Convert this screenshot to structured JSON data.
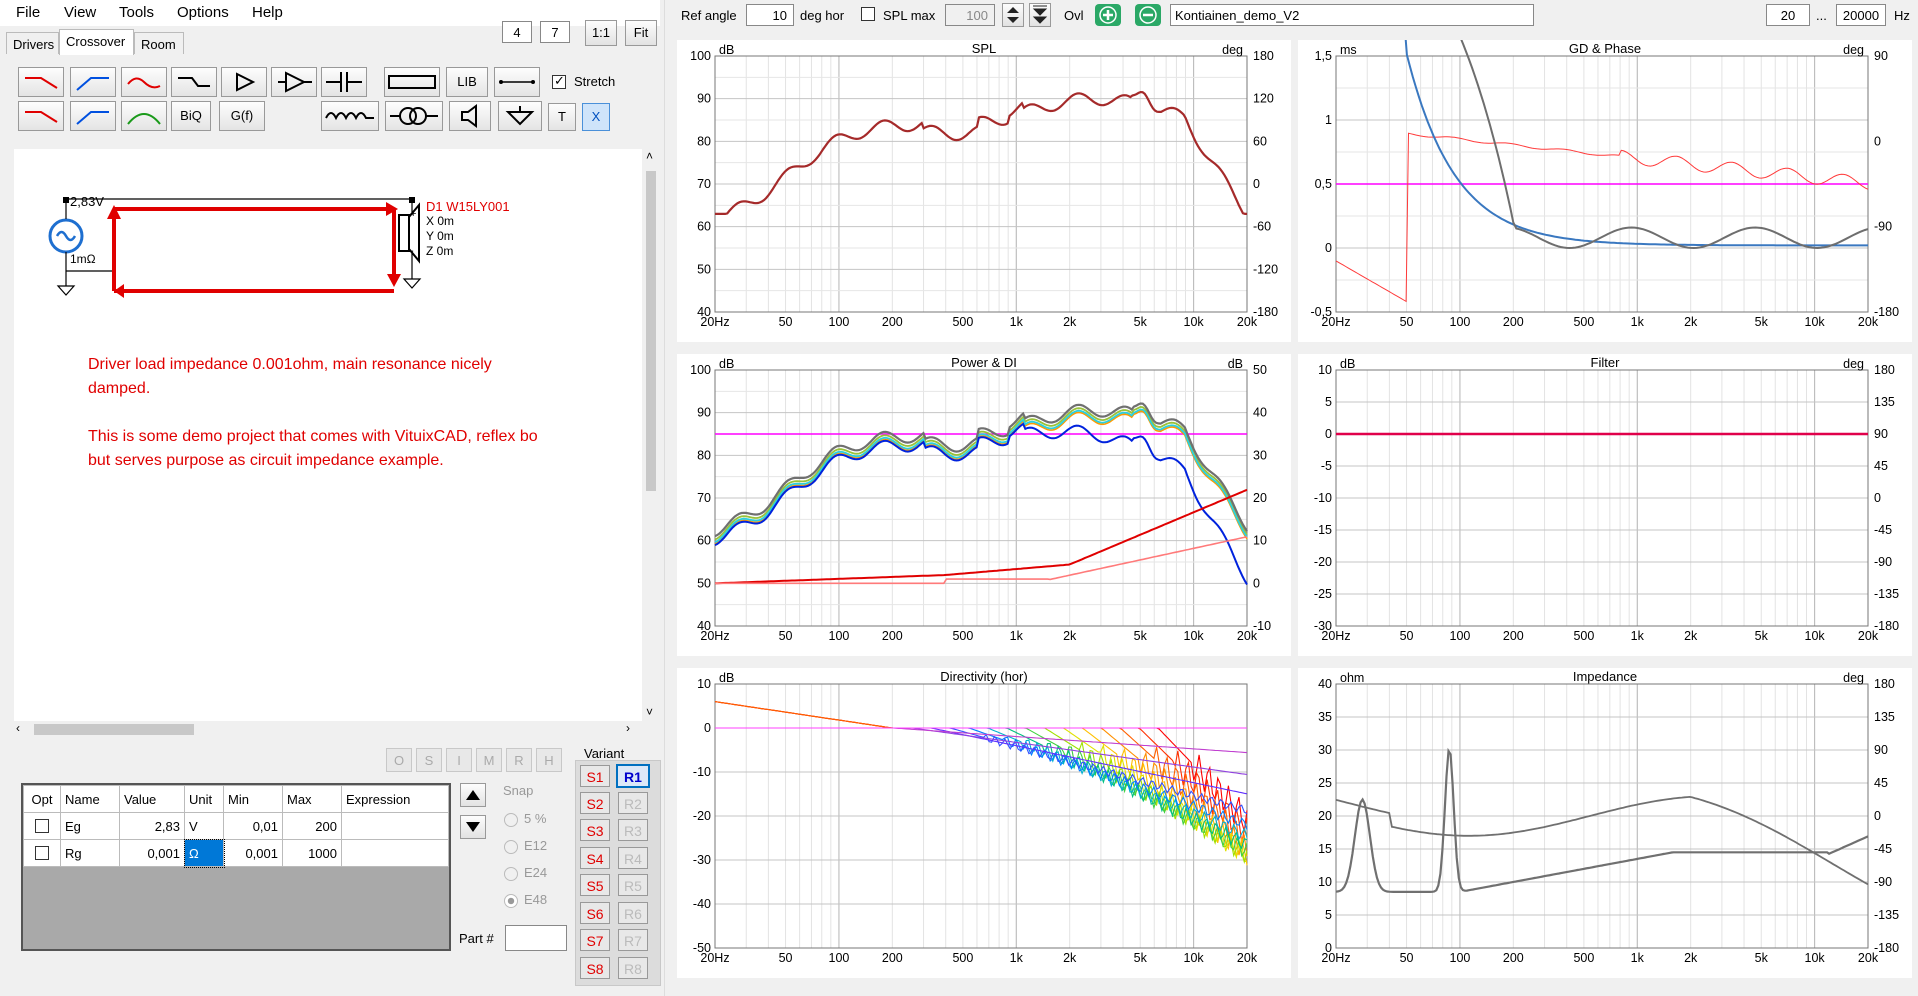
{
  "menu": [
    "File",
    "View",
    "Tools",
    "Options",
    "Help"
  ],
  "tabs": [
    "Drivers",
    "Crossover",
    "Room"
  ],
  "zoom": {
    "a": "4",
    "b": "7",
    "one_to_one": "1:1",
    "fit": "Fit"
  },
  "toolbar": {
    "biq": "BiQ",
    "gf": "G(f)",
    "lib": "LIB",
    "t": "T",
    "x": "X",
    "stretch_label": "Stretch",
    "stretch_checked": true
  },
  "schematic": {
    "source_voltage": "2,83V",
    "source_resistance": "1mΩ",
    "driver_name": "D1 W15LY001",
    "driver_x": "X 0m",
    "driver_y": "Y 0m",
    "driver_z": "Z 0m",
    "plus": "+",
    "minus": "-",
    "note1": "Driver load impedance 0.001ohm, main resonance nicely",
    "note2": "damped.",
    "note3": "This is some demo project that comes with VituixCAD, reflex bo",
    "note4": "but serves purpose as circuit impedance example."
  },
  "small_buttons": [
    "O",
    "S",
    "I",
    "M",
    "R",
    "H"
  ],
  "params": {
    "headers": [
      "Opt",
      "Name",
      "Value",
      "Unit",
      "Min",
      "Max",
      "Expression"
    ],
    "rows": [
      {
        "name": "Eg",
        "value": "2,83",
        "unit": "V",
        "min": "0,01",
        "max": "200",
        "expr": ""
      },
      {
        "name": "Rg",
        "value": "0,001",
        "unit": "Ω",
        "min": "0,001",
        "max": "1000",
        "expr": ""
      }
    ]
  },
  "snap": {
    "label": "Snap",
    "options": [
      "5 %",
      "E12",
      "E24",
      "E48"
    ],
    "selected": "E48"
  },
  "part_label": "Part #",
  "variant": {
    "label": "Variant",
    "s": [
      "S1",
      "S2",
      "S3",
      "S4",
      "S5",
      "S6",
      "S7",
      "S8"
    ],
    "r": [
      "R1",
      "R2",
      "R3",
      "R4",
      "R5",
      "R6",
      "R7",
      "R8"
    ],
    "active_r": "R1"
  },
  "top_controls": {
    "ref_angle_label": "Ref angle",
    "ref_angle": "10",
    "deg_hor": "deg hor",
    "spl_max_label": "SPL max",
    "spl_max": "100",
    "ovl": "Ovl",
    "project": "Kontiainen_demo_V2",
    "f_min": "20",
    "dots": "...",
    "f_max": "20000",
    "hz": "Hz"
  },
  "x_ticks": [
    "20Hz",
    "50",
    "100",
    "200",
    "500",
    "1k",
    "2k",
    "5k",
    "10k",
    "20k"
  ],
  "plots": {
    "spl": {
      "title": "SPL",
      "left_unit": "dB",
      "right_unit": "deg",
      "left_ticks": [
        "100",
        "90",
        "80",
        "70",
        "60",
        "50",
        "40"
      ],
      "right_ticks": [
        "180",
        "120",
        "60",
        "0",
        "-60",
        "-120",
        "-180"
      ]
    },
    "gd": {
      "title": "GD & Phase",
      "left_unit": "ms",
      "right_unit": "deg",
      "left_ticks": [
        "1,5",
        "1",
        "0,5",
        "0",
        "-0,5"
      ],
      "right_ticks": [
        "90",
        "0",
        "-90",
        "-180"
      ]
    },
    "power": {
      "title": "Power & DI",
      "left_unit": "dB",
      "right_unit": "dB",
      "left_ticks": [
        "100",
        "90",
        "80",
        "70",
        "60",
        "50",
        "40"
      ],
      "right_ticks": [
        "50",
        "40",
        "30",
        "20",
        "10",
        "0",
        "-10"
      ]
    },
    "filter": {
      "title": "Filter",
      "left_unit": "dB",
      "right_unit": "deg",
      "left_ticks": [
        "10",
        "5",
        "0",
        "-5",
        "-10",
        "-15",
        "-20",
        "-25",
        "-30"
      ],
      "right_ticks": [
        "180",
        "135",
        "90",
        "45",
        "0",
        "-45",
        "-90",
        "-135",
        "-180"
      ]
    },
    "directivity": {
      "title": "Directivity (hor)",
      "left_unit": "dB",
      "left_ticks": [
        "10",
        "0",
        "-10",
        "-20",
        "-30",
        "-40",
        "-50"
      ]
    },
    "impedance": {
      "title": "Impedance",
      "left_unit": "ohm",
      "right_unit": "deg",
      "left_ticks": [
        "40",
        "35",
        "30",
        "25",
        "20",
        "15",
        "10",
        "5",
        "0"
      ],
      "right_ticks": [
        "180",
        "135",
        "90",
        "45",
        "0",
        "-45",
        "-90",
        "-135",
        "-180"
      ]
    }
  },
  "colors": {
    "spl": "#a52a2a",
    "pink": "#ff00ff",
    "red": "#e00000",
    "blue": "#0000cc",
    "gray": "#707070"
  }
}
